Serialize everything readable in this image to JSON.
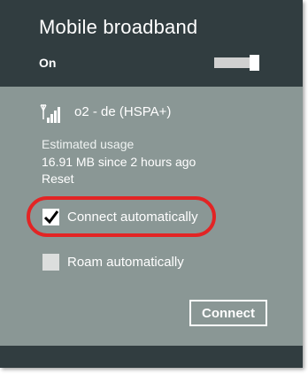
{
  "header": {
    "title": "Mobile broadband",
    "toggle_label": "On",
    "toggle_state": "on"
  },
  "network": {
    "icon": "signal-bars-icon",
    "name": "o2 - de (HSPA+)"
  },
  "usage": {
    "label": "Estimated usage",
    "value": "16.91 MB since 2 hours ago",
    "reset_label": "Reset"
  },
  "options": {
    "connect_auto_label": "Connect automatically",
    "connect_auto_checked": true,
    "roam_auto_label": "Roam automatically",
    "roam_auto_checked": false
  },
  "actions": {
    "connect_label": "Connect"
  },
  "colors": {
    "header_bg": "#313d40",
    "panel_bg": "#8a9795",
    "highlight": "#e32424"
  }
}
